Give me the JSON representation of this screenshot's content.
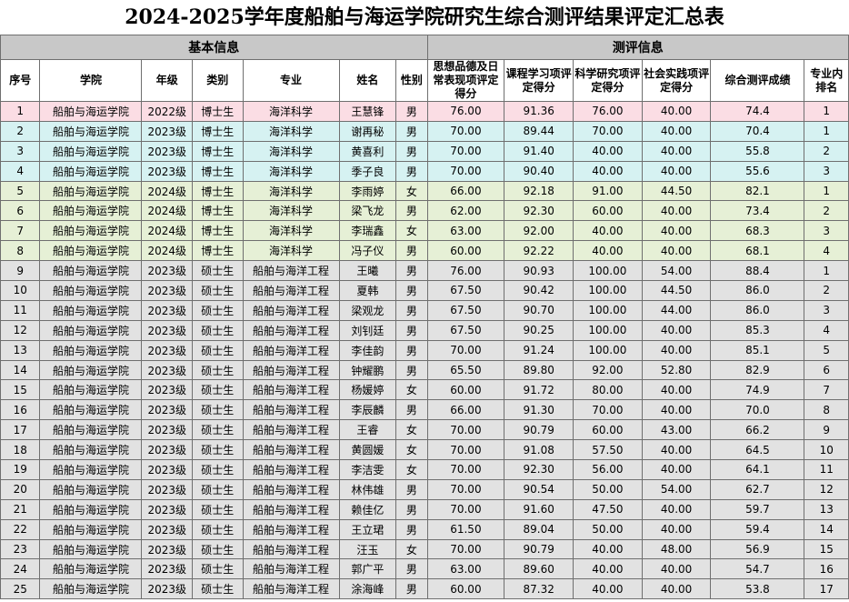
{
  "title": "2024-2025学年度船舶与海运学院研究生综合测评结果评定汇总表",
  "groups": {
    "basic": "基本信息",
    "eval": "测评信息"
  },
  "headers": [
    "序号",
    "学院",
    "年级",
    "类别",
    "专业",
    "姓名",
    "性别",
    "思想品德及日常表现项评定得分",
    "课程学习项评定得分",
    "科学研究项评定得分",
    "社会实践项评定得分",
    "综合测评成绩",
    "专业内排名"
  ],
  "colors": {
    "pink": "#fbdde4",
    "cyan": "#d6f2f2",
    "green": "#e6f0d6",
    "gray": "#e2e2e2",
    "group_header": "#c8c8c8"
  },
  "rows": [
    [
      "1",
      "船舶与海运学院",
      "2022级",
      "博士生",
      "海洋科学",
      "王慧锋",
      "男",
      "76.00",
      "91.36",
      "76.00",
      "40.00",
      "74.4",
      "1"
    ],
    [
      "2",
      "船舶与海运学院",
      "2023级",
      "博士生",
      "海洋科学",
      "谢再秘",
      "男",
      "70.00",
      "89.44",
      "70.00",
      "40.00",
      "70.4",
      "1"
    ],
    [
      "3",
      "船舶与海运学院",
      "2023级",
      "博士生",
      "海洋科学",
      "黄喜利",
      "男",
      "70.00",
      "91.40",
      "40.00",
      "40.00",
      "55.8",
      "2"
    ],
    [
      "4",
      "船舶与海运学院",
      "2023级",
      "博士生",
      "海洋科学",
      "季子良",
      "男",
      "70.00",
      "90.40",
      "40.00",
      "40.00",
      "55.6",
      "3"
    ],
    [
      "5",
      "船舶与海运学院",
      "2024级",
      "博士生",
      "海洋科学",
      "李雨婷",
      "女",
      "66.00",
      "92.18",
      "91.00",
      "44.50",
      "82.1",
      "1"
    ],
    [
      "6",
      "船舶与海运学院",
      "2024级",
      "博士生",
      "海洋科学",
      "梁飞龙",
      "男",
      "62.00",
      "92.30",
      "60.00",
      "40.00",
      "73.4",
      "2"
    ],
    [
      "7",
      "船舶与海运学院",
      "2024级",
      "博士生",
      "海洋科学",
      "李瑞鑫",
      "女",
      "63.00",
      "92.00",
      "40.00",
      "40.00",
      "68.3",
      "3"
    ],
    [
      "8",
      "船舶与海运学院",
      "2024级",
      "博士生",
      "海洋科学",
      "冯子仪",
      "男",
      "60.00",
      "92.22",
      "40.00",
      "40.00",
      "68.1",
      "4"
    ],
    [
      "9",
      "船舶与海运学院",
      "2023级",
      "硕士生",
      "船舶与海洋工程",
      "王曦",
      "男",
      "76.00",
      "90.93",
      "100.00",
      "54.00",
      "88.4",
      "1"
    ],
    [
      "10",
      "船舶与海运学院",
      "2023级",
      "硕士生",
      "船舶与海洋工程",
      "夏韩",
      "男",
      "67.50",
      "90.42",
      "100.00",
      "44.50",
      "86.0",
      "2"
    ],
    [
      "11",
      "船舶与海运学院",
      "2023级",
      "硕士生",
      "船舶与海洋工程",
      "梁观龙",
      "男",
      "67.50",
      "90.70",
      "100.00",
      "44.00",
      "86.0",
      "3"
    ],
    [
      "12",
      "船舶与海运学院",
      "2023级",
      "硕士生",
      "船舶与海洋工程",
      "刘钊廷",
      "男",
      "67.50",
      "90.25",
      "100.00",
      "40.00",
      "85.3",
      "4"
    ],
    [
      "13",
      "船舶与海运学院",
      "2023级",
      "硕士生",
      "船舶与海洋工程",
      "李佳韵",
      "男",
      "70.00",
      "91.24",
      "100.00",
      "40.00",
      "85.1",
      "5"
    ],
    [
      "14",
      "船舶与海运学院",
      "2023级",
      "硕士生",
      "船舶与海洋工程",
      "钟耀鹏",
      "男",
      "65.50",
      "89.80",
      "92.00",
      "52.80",
      "82.9",
      "6"
    ],
    [
      "15",
      "船舶与海运学院",
      "2023级",
      "硕士生",
      "船舶与海洋工程",
      "杨媛婷",
      "女",
      "60.00",
      "91.72",
      "80.00",
      "40.00",
      "74.9",
      "7"
    ],
    [
      "16",
      "船舶与海运学院",
      "2023级",
      "硕士生",
      "船舶与海洋工程",
      "李辰麟",
      "男",
      "66.00",
      "91.30",
      "70.00",
      "40.00",
      "70.0",
      "8"
    ],
    [
      "17",
      "船舶与海运学院",
      "2023级",
      "硕士生",
      "船舶与海洋工程",
      "王睿",
      "女",
      "70.00",
      "90.79",
      "60.00",
      "43.00",
      "66.2",
      "9"
    ],
    [
      "18",
      "船舶与海运学院",
      "2023级",
      "硕士生",
      "船舶与海洋工程",
      "黄圆媛",
      "女",
      "70.00",
      "91.08",
      "57.50",
      "40.00",
      "64.5",
      "10"
    ],
    [
      "19",
      "船舶与海运学院",
      "2023级",
      "硕士生",
      "船舶与海洋工程",
      "李洁雯",
      "女",
      "70.00",
      "92.30",
      "56.00",
      "40.00",
      "64.1",
      "11"
    ],
    [
      "20",
      "船舶与海运学院",
      "2023级",
      "硕士生",
      "船舶与海洋工程",
      "林伟雄",
      "男",
      "70.00",
      "90.54",
      "50.00",
      "54.00",
      "62.7",
      "12"
    ],
    [
      "21",
      "船舶与海运学院",
      "2023级",
      "硕士生",
      "船舶与海洋工程",
      "赖佳亿",
      "男",
      "70.00",
      "91.60",
      "47.50",
      "40.00",
      "59.7",
      "13"
    ],
    [
      "22",
      "船舶与海运学院",
      "2023级",
      "硕士生",
      "船舶与海洋工程",
      "王立珺",
      "男",
      "61.50",
      "89.04",
      "50.00",
      "40.00",
      "59.4",
      "14"
    ],
    [
      "23",
      "船舶与海运学院",
      "2023级",
      "硕士生",
      "船舶与海洋工程",
      "汪玉",
      "女",
      "70.00",
      "90.79",
      "40.00",
      "48.00",
      "56.9",
      "15"
    ],
    [
      "24",
      "船舶与海运学院",
      "2023级",
      "硕士生",
      "船舶与海洋工程",
      "郭广平",
      "男",
      "63.00",
      "89.60",
      "40.00",
      "40.00",
      "54.7",
      "16"
    ],
    [
      "25",
      "船舶与海运学院",
      "2023级",
      "硕士生",
      "船舶与海洋工程",
      "涂海峰",
      "男",
      "60.00",
      "87.32",
      "40.00",
      "40.00",
      "53.8",
      "17"
    ]
  ],
  "row_groups": [
    "pink",
    "cyan",
    "cyan",
    "cyan",
    "green",
    "green",
    "green",
    "green",
    "gray",
    "gray",
    "gray",
    "gray",
    "gray",
    "gray",
    "gray",
    "gray",
    "gray",
    "gray",
    "gray",
    "gray",
    "gray",
    "gray",
    "gray",
    "gray",
    "gray"
  ]
}
